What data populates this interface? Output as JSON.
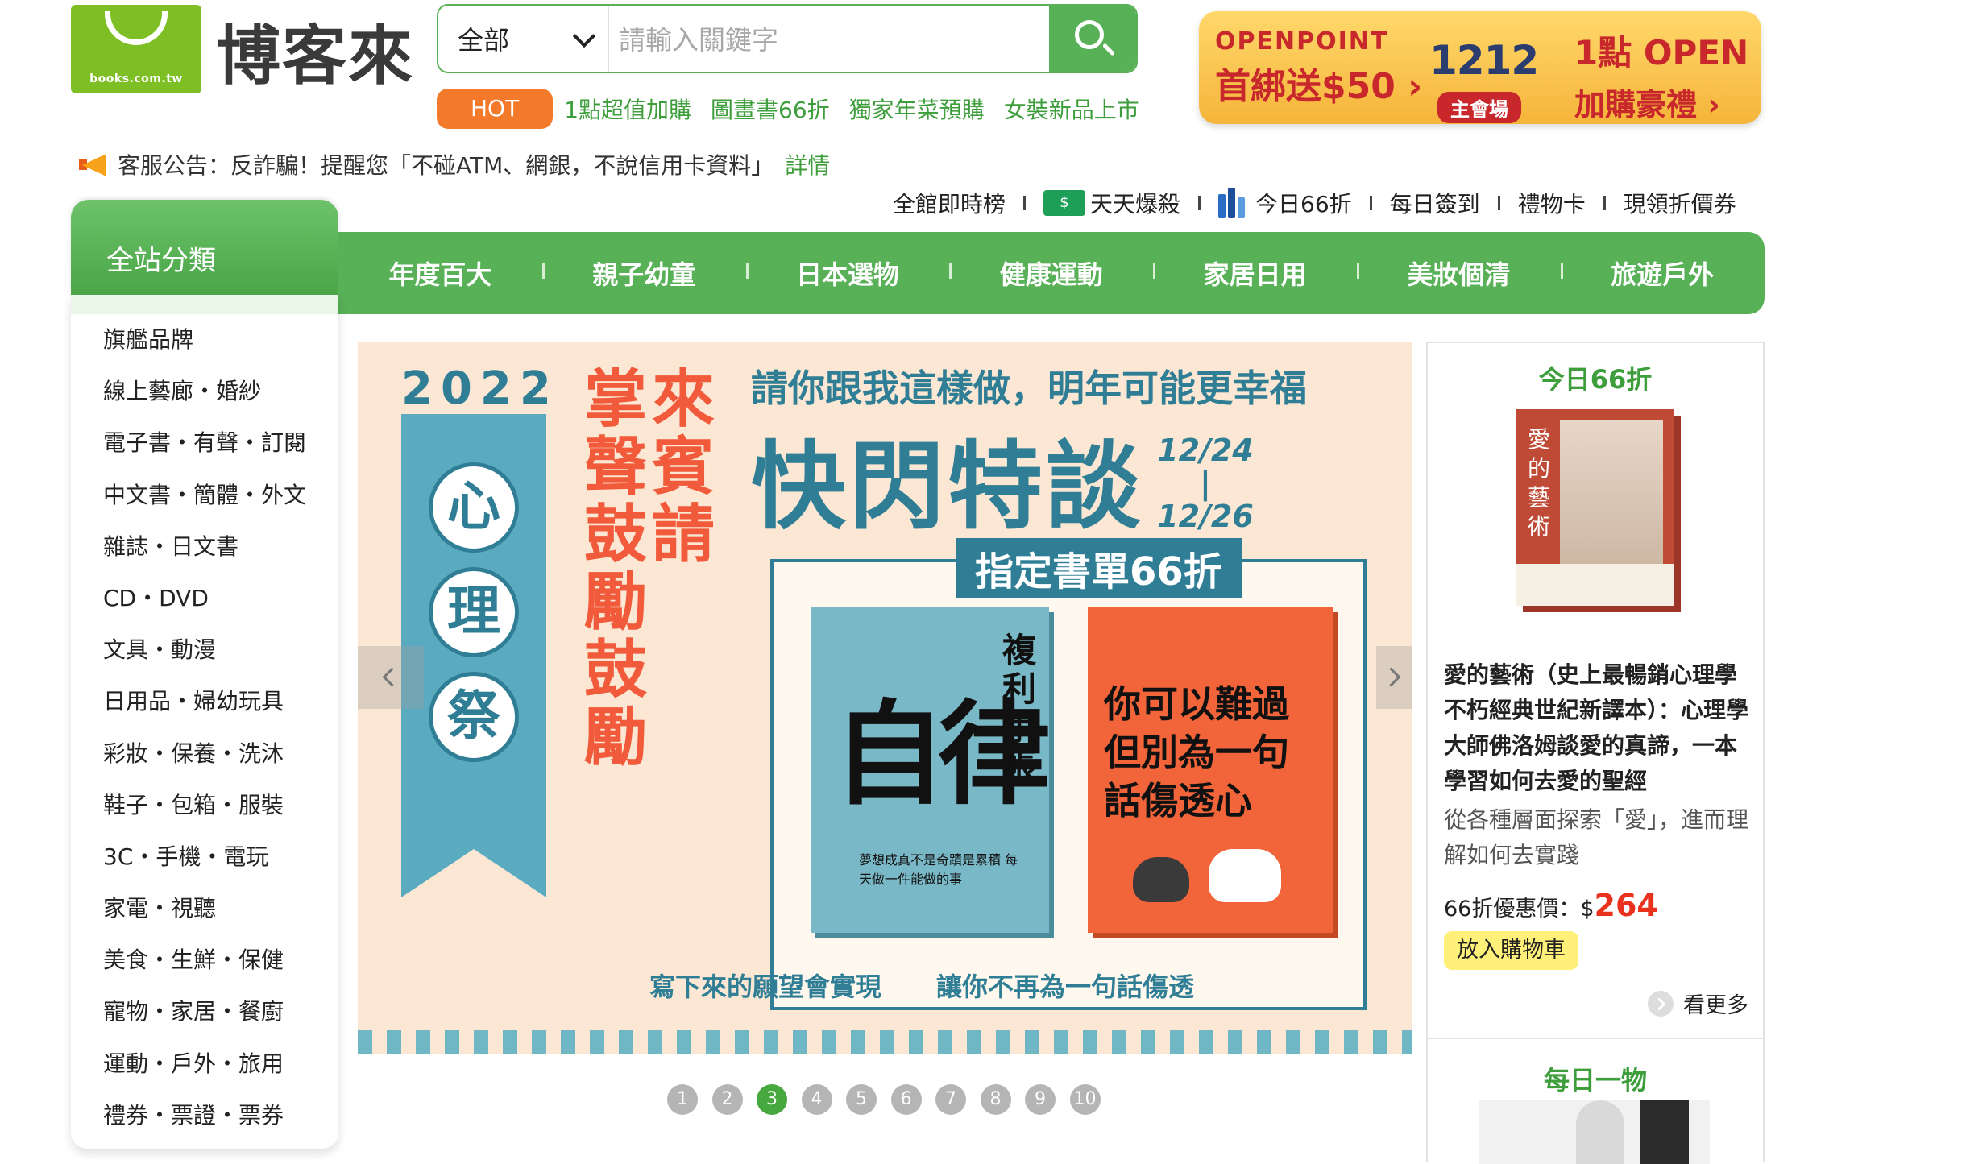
{
  "header": {
    "logo_domain": "books.com.tw",
    "logo_text": "博客來",
    "search": {
      "category": "全部",
      "placeholder": "請輸入關鍵字"
    },
    "hot": {
      "badge": "HOT",
      "links": [
        "1點超值加購",
        "圖畫書66折",
        "獨家年菜預購",
        "女裝新品上市"
      ]
    },
    "promo": {
      "brand": "OPENPOINT",
      "gift": "首綁送$50 ›",
      "big_number": "1212",
      "venue": "主會場",
      "points_title": "1點 OPEN POINT",
      "points_sub": "加購豪禮 ›"
    }
  },
  "notice": {
    "text": "客服公告：反詐騙！提醒您「不碰ATM、網銀，不說信用卡資料」",
    "link": "詳情"
  },
  "quick_links": [
    "全館即時榜",
    "天天爆殺",
    "今日66折",
    "每日簽到",
    "禮物卡",
    "現領折價券"
  ],
  "nav": {
    "category_tab": "全站分類",
    "items": [
      "年度百大",
      "親子幼童",
      "日本選物",
      "健康運動",
      "家居日用",
      "美妝個清",
      "旅遊戶外"
    ]
  },
  "sidebar": {
    "items": [
      "旗艦品牌",
      "線上藝廊・婚紗",
      "電子書・有聲・訂閱",
      "中文書・簡體・外文",
      "雜誌・日文書",
      "CD・DVD",
      "文具・動漫",
      "日用品・婦幼玩具",
      "彩妝・保養・洗沐",
      "鞋子・包箱・服裝",
      "3C・手機・電玩",
      "家電・視聽",
      "美食・生鮮・保健",
      "寵物・家居・餐廚",
      "運動・戶外・旅用",
      "禮券・票證・票券"
    ]
  },
  "banner": {
    "year": "2022",
    "festival": [
      "心",
      "理",
      "祭"
    ],
    "vertical_left": "掌聲鼓勵鼓勵",
    "vertical_right": "來賓請",
    "headline": "請你跟我這樣做，明年可能更幸福",
    "big_title": "快閃特談",
    "date_start": "12/24",
    "date_sep": "|",
    "date_end": "12/26",
    "booklist_tag": "指定書單66折",
    "book1_title": "自律",
    "book1_sub": "複利手帳",
    "book1_tagline": "夢想成真不是奇蹟是累積 每天做一件能做的事",
    "book2_title": "你可以難過 但別為一句話傷透心",
    "caption_left": "寫下來的願望會實現",
    "caption_right": "讓你不再為一句話傷透",
    "slides": [
      "1",
      "2",
      "3",
      "4",
      "5",
      "6",
      "7",
      "8",
      "9",
      "10"
    ],
    "active_slide": 3
  },
  "right_panel": {
    "title": "今日66折",
    "book_cover_title": "愛的藝術",
    "product_name": "愛的藝術（史上最暢銷心理學不朽經典世紀新譯本）：心理學大師佛洛姆談愛的真諦，一本學習如何去愛的聖經",
    "description": "從各種層面探索「愛」，進而理解如何去實踐",
    "price_label": "66折優惠價：$",
    "price": "264",
    "cart_button": "放入購物車",
    "more": "看更多",
    "title2": "每日一物"
  },
  "colors": {
    "brand_green": "#58b057",
    "hot_orange": "#f37a2a",
    "price_red": "#e8321e",
    "banner_teal": "#2f7e95",
    "banner_orange": "#f15b3b"
  }
}
